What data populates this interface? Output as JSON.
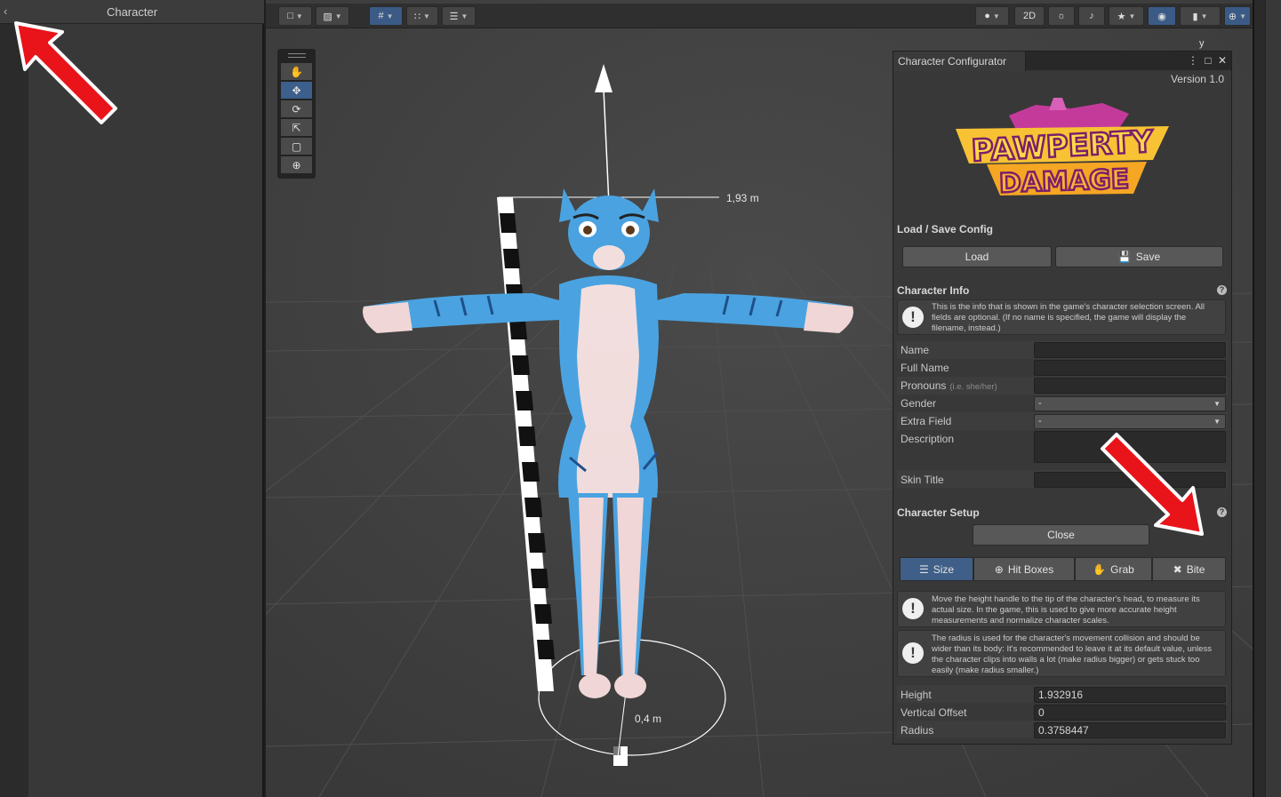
{
  "hierarchy": {
    "title": "Character"
  },
  "scene": {
    "height_label": "1,93 m",
    "radius_label": "0,4 m",
    "axis_label": "y",
    "toolbar": {
      "mode_2d": "2D"
    }
  },
  "configurator": {
    "tab_title": "Character Configurator",
    "version": "Version 1.0",
    "logo": {
      "line1": "PAWPERTY",
      "line2": "DAMAGE"
    },
    "load_save": {
      "title": "Load / Save Config",
      "load_label": "Load",
      "save_label": "Save"
    },
    "character_info": {
      "title": "Character Info",
      "help_text": "This is the info that is shown in the game's character selection screen. All fields are optional. (If no name is specified, the game will display the filename, instead.)",
      "fields": {
        "name_label": "Name",
        "name_value": "",
        "full_name_label": "Full Name",
        "full_name_value": "",
        "pronouns_label": "Pronouns",
        "pronouns_hint": "(i.e. she/her)",
        "pronouns_value": "",
        "gender_label": "Gender",
        "gender_value": "-",
        "extra_label": "Extra Field",
        "extra_value": "-",
        "description_label": "Description",
        "description_value": "",
        "skin_title_label": "Skin Title",
        "skin_title_value": ""
      }
    },
    "character_setup": {
      "title": "Character Setup",
      "close_label": "Close",
      "tabs": {
        "size": "Size",
        "hitboxes": "Hit Boxes",
        "grab": "Grab",
        "bite": "Bite"
      },
      "help_height": "Move the height handle to the tip of the character's head, to measure its actual size. In the game, this is used to give more accurate height measurements and normalize character scales.",
      "help_radius": "The radius is used for the character's movement collision and should be wider than its body: It's recommended to leave it at its default value, unless the character clips into walls a lot (make radius bigger) or gets stuck too easily (make radius smaller.)",
      "height_label": "Height",
      "height_value": "1.932916",
      "offset_label": "Vertical Offset",
      "offset_value": "0",
      "radius_label": "Radius",
      "radius_value": "0.3758447"
    }
  },
  "colors": {
    "accent": "#3f5f88",
    "arrow": "#e8141a",
    "character_blue": "#4aa3e0",
    "character_pink": "#f0d8d8"
  }
}
